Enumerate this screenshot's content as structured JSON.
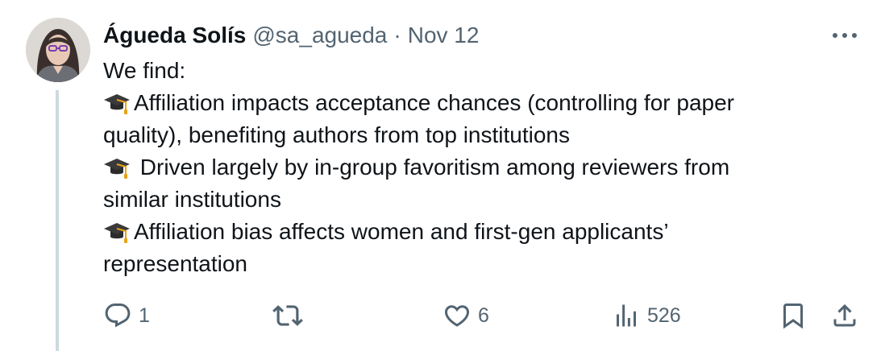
{
  "tweet": {
    "author_name": "Águeda Solís",
    "handle": "@sa_agueda",
    "separator": "·",
    "date": "Nov 12",
    "lines": [
      {
        "emoji": "",
        "text": "We find:"
      },
      {
        "emoji": "graduation-cap",
        "text": "Affiliation impacts acceptance chances (controlling for paper"
      },
      {
        "emoji": "",
        "text": "quality), benefiting authors from top institutions"
      },
      {
        "emoji": "graduation-cap",
        "text": " Driven largely by in-group favoritism among reviewers from"
      },
      {
        "emoji": "",
        "text": "similar institutions"
      },
      {
        "emoji": "graduation-cap",
        "text": "Affiliation bias affects women and first-gen applicants’"
      },
      {
        "emoji": "",
        "text": "representation"
      }
    ],
    "metrics": {
      "replies": "1",
      "reposts": "",
      "likes": "6",
      "views": "526"
    }
  },
  "icons": {
    "more": "more-horizontal-icon",
    "reply": "reply-icon",
    "repost": "repost-icon",
    "like": "heart-icon",
    "views": "views-chart-icon",
    "bookmark": "bookmark-icon",
    "share": "share-icon"
  },
  "colors": {
    "text": "#0f1419",
    "secondary": "#536471",
    "thread_line": "#cfd9de"
  }
}
